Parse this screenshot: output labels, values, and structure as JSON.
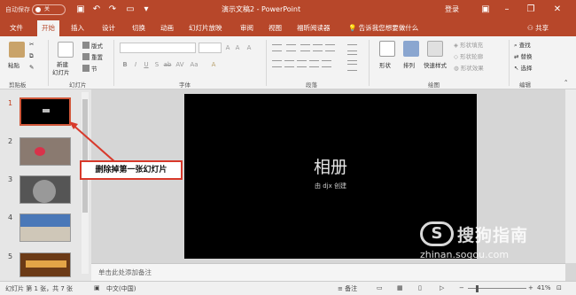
{
  "titlebar": {
    "autosave_label": "自动保存",
    "autosave_state": "关",
    "doc_title": "演示文稿2 - PowerPoint",
    "login": "登录",
    "accent_color": "#b7472a"
  },
  "tabs": [
    "文件",
    "开始",
    "插入",
    "设计",
    "切换",
    "动画",
    "幻灯片放映",
    "审阅",
    "视图",
    "福昕阅读器"
  ],
  "active_tab": "开始",
  "tell_me": "告诉我您想要做什么",
  "share": "共享",
  "ribbon": {
    "clipboard": {
      "paste": "粘贴",
      "label": "剪贴板"
    },
    "slides": {
      "new_slide": "新建",
      "new_slide2": "幻灯片",
      "layout": "版式",
      "reset": "重置",
      "section": "节",
      "label": "幻灯片"
    },
    "font": {
      "label": "字体"
    },
    "paragraph": {
      "label": "段落"
    },
    "drawing": {
      "shape": "形状",
      "arrange": "排列",
      "quick_styles": "快速样式",
      "fill": "形状填充",
      "outline": "形状轮廓",
      "effects": "形状效果",
      "label": "绘图"
    },
    "editing": {
      "find": "查找",
      "replace": "替换",
      "select": "选择",
      "label": "编辑"
    }
  },
  "thumbnails": [
    {
      "num": "1",
      "selected": true
    },
    {
      "num": "2",
      "selected": false
    },
    {
      "num": "3",
      "selected": false
    },
    {
      "num": "4",
      "selected": false
    },
    {
      "num": "5",
      "selected": false
    }
  ],
  "slide": {
    "title": "相册",
    "subtitle": "由 djx 创建"
  },
  "notes_placeholder": "单击此处添加备注",
  "status": {
    "slide_count": "幻灯片 第 1 张，共 7 张",
    "language": "中文(中国)",
    "notes": "备注",
    "zoom": "41%"
  },
  "annotation": "删除掉第一张幻灯片",
  "watermark": {
    "brand": "搜狗指南",
    "url": "zhinan.sogou.com"
  }
}
